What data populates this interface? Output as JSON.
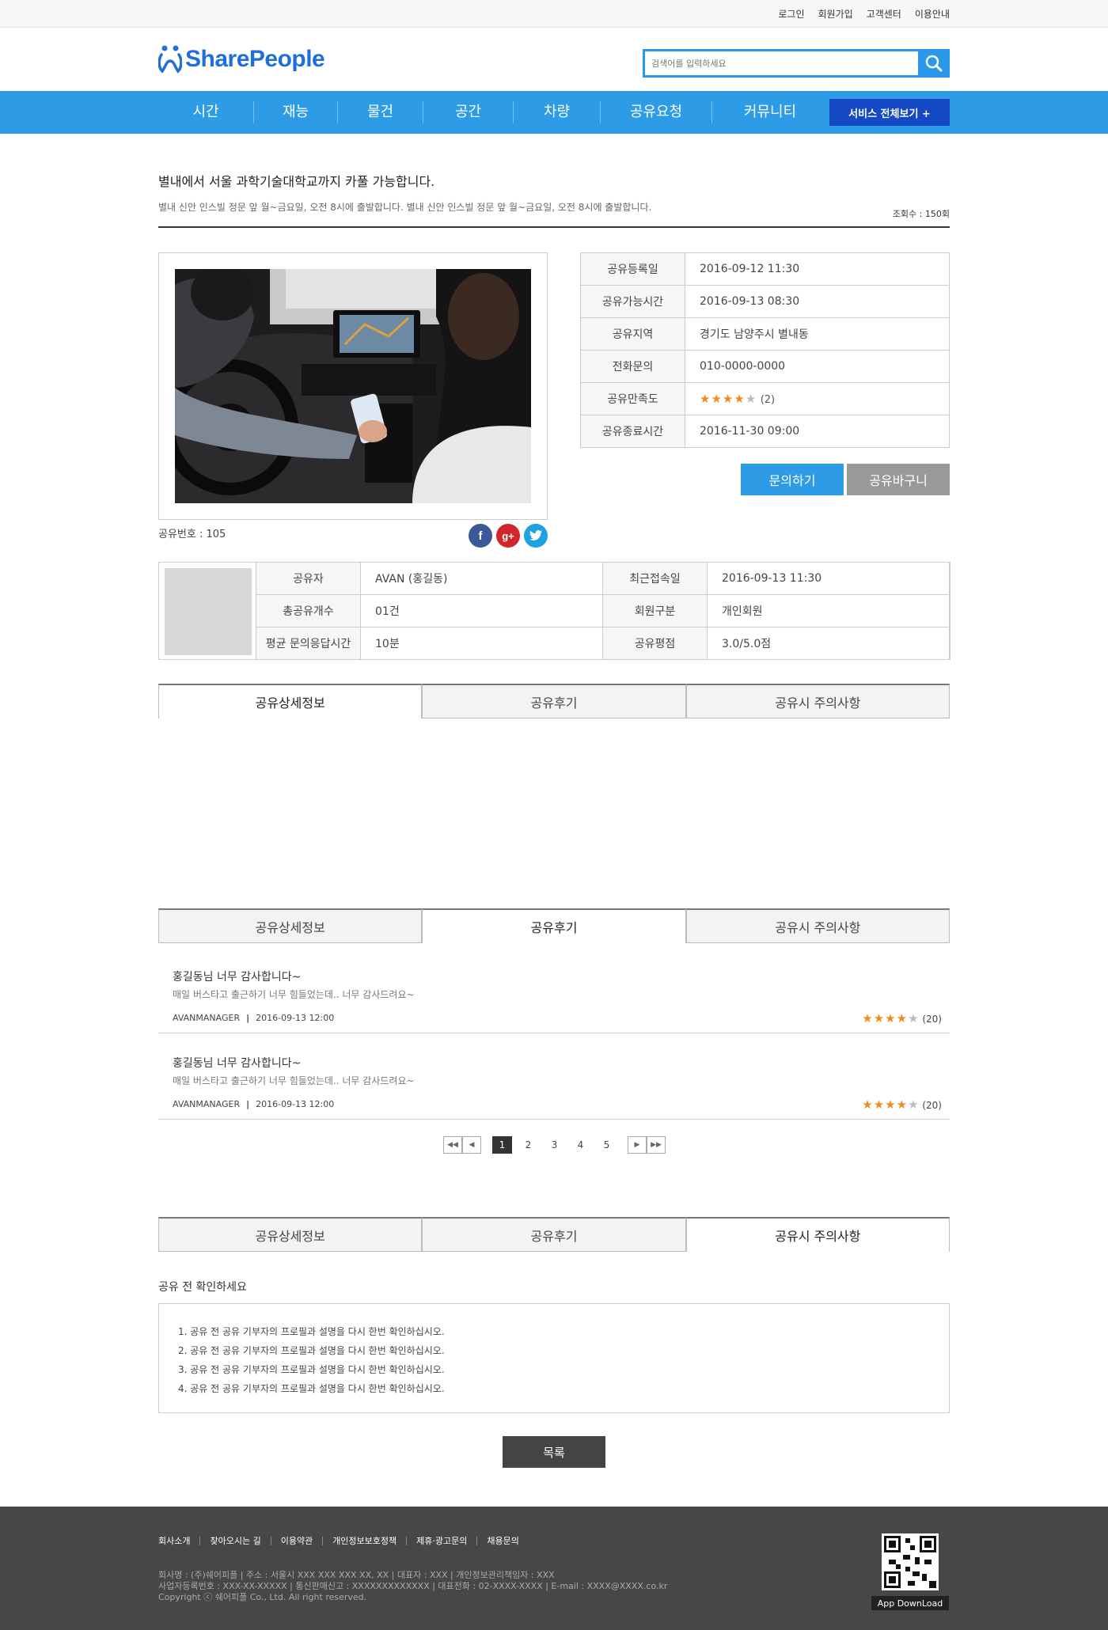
{
  "top_links": [
    "로그인",
    "회원가입",
    "고객센터",
    "이용안내"
  ],
  "logo": {
    "text": "SharePeople"
  },
  "search": {
    "placeholder": "검색어를 입력하세요"
  },
  "nav": {
    "items": [
      "시간",
      "재능",
      "물건",
      "공간",
      "차량",
      "공유요청",
      "커뮤니티"
    ],
    "all_button": "서비스 전체보기 +"
  },
  "post": {
    "title": "별내에서 서울 과학기술대학교까지 카풀 가능합니다.",
    "subtitle": "별내 신안 인스빌 정문 앞 월~금요일, 오전 8시에 출발합니다. 별내 신안 인스빌 정문 앞 월~금요일, 오전 8시에 출발합니다.",
    "views": "조회수 : 150회",
    "share_no": "공유번호 : 105"
  },
  "info": [
    {
      "key": "공유등록일",
      "value": "2016-09-12 11:30"
    },
    {
      "key": "공유가능시간",
      "value": "2016-09-13 08:30"
    },
    {
      "key": "공유지역",
      "value": "경기도 남양주시 별내동"
    },
    {
      "key": "전화문의",
      "value": "010-0000-0000"
    },
    {
      "key": "공유만족도",
      "value": "(2)",
      "rating": 4
    },
    {
      "key": "공유종료시간",
      "value": "2016-11-30 09:00"
    }
  ],
  "buttons": {
    "inquiry": "문의하기",
    "cart": "공유바구니",
    "list": "목록"
  },
  "owner": {
    "rows": [
      {
        "k1": "공유자",
        "v1": "AVAN (홍길동)",
        "k2": "최근접속일",
        "v2": "2016-09-13 11:30"
      },
      {
        "k1": "총공유개수",
        "v1": "01건",
        "k2": "회원구분",
        "v2": "개인회원"
      },
      {
        "k1": "평균 문의응답시간",
        "v1": "10분",
        "k2": "공유평점",
        "v2": "3.0/5.0점"
      }
    ]
  },
  "tabs": [
    "공유상세정보",
    "공유후기",
    "공유시 주의사항"
  ],
  "reviews": [
    {
      "title": "홍길동님 너무 감사합니다~",
      "body": "매일 버스타고 출근하기 너무 힘들었는데.. 너무 감사드려요~",
      "author": "AVANMANAGER",
      "date": "2016-09-13 12:00",
      "rating": 4,
      "count": "(20)"
    },
    {
      "title": "홍길동님 너무 감사합니다~",
      "body": "매일 버스타고 출근하기 너무 힘들었는데.. 너무 감사드려요~",
      "author": "AVANMANAGER",
      "date": "2016-09-13 12:00",
      "rating": 4,
      "count": "(20)"
    }
  ],
  "pagination": {
    "pages": [
      "1",
      "2",
      "3",
      "4",
      "5"
    ],
    "current": "1"
  },
  "notice": {
    "title": "공유 전 확인하세요",
    "items": [
      "1. 공유 전 공유 기부자의 프로필과 설명을 다시 한번 확인하십시오.",
      "2. 공유 전 공유 기부자의 프로필과 설명을 다시 한번 확인하십시오.",
      "3. 공유 전 공유 기부자의 프로필과 설명을 다시 한번 확인하십시오.",
      "4. 공유 전 공유 기부자의 프로필과 설명을 다시 한번 확인하십시오."
    ]
  },
  "footer": {
    "links": [
      "회사소개",
      "찾아오시는 길",
      "이용약관",
      "개인정보보호정책",
      "제휴·광고문의",
      "채용문의"
    ],
    "info_lines": [
      "회사명 : (주)쉐어피플  |  주소 : 서울시 XXX XXX XXX XX, XX  |  대표자 : XXX  |  개인정보관리책임자 : XXX",
      "사업자등록번호 : XXX-XX-XXXXX  | 통신판매신고 : XXXXXXXXXXXXX  | 대표전화 : 02-XXXX-XXXX  |  E-mail : XXXX@XXXX.co.kr",
      "Copyright ⓒ 쉐어피플 Co., Ltd. All right reserved."
    ],
    "app_download": "App DownLoad"
  },
  "colors": {
    "accent": "#2e9be6",
    "nav_all": "#1448c4",
    "star": "#f08a1c",
    "footer": "#474747"
  },
  "icons": [
    "search-icon",
    "facebook-icon",
    "google-plus-icon",
    "twitter-icon",
    "star-icon",
    "first-page-icon",
    "prev-page-icon",
    "next-page-icon",
    "last-page-icon",
    "qr-code"
  ]
}
